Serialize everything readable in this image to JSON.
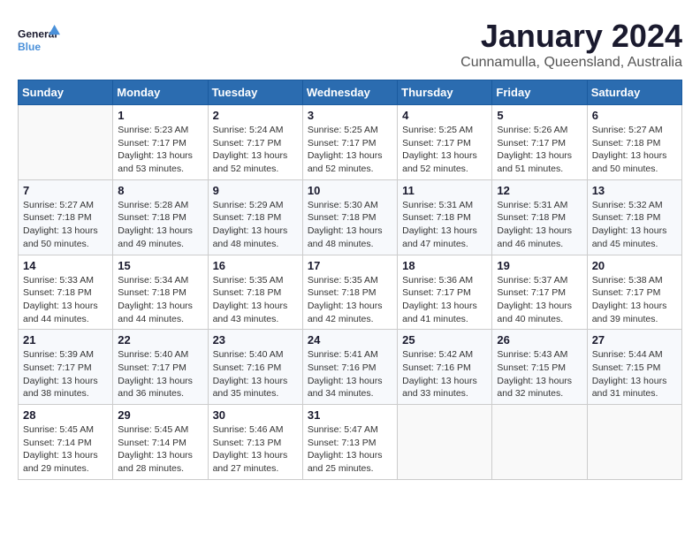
{
  "header": {
    "logo_line1": "General",
    "logo_line2": "Blue",
    "month_year": "January 2024",
    "location": "Cunnamulla, Queensland, Australia"
  },
  "weekdays": [
    "Sunday",
    "Monday",
    "Tuesday",
    "Wednesday",
    "Thursday",
    "Friday",
    "Saturday"
  ],
  "weeks": [
    [
      {
        "day": "",
        "empty": true
      },
      {
        "day": "1",
        "sunrise": "5:23 AM",
        "sunset": "7:17 PM",
        "daylight": "13 hours and 53 minutes."
      },
      {
        "day": "2",
        "sunrise": "5:24 AM",
        "sunset": "7:17 PM",
        "daylight": "13 hours and 52 minutes."
      },
      {
        "day": "3",
        "sunrise": "5:25 AM",
        "sunset": "7:17 PM",
        "daylight": "13 hours and 52 minutes."
      },
      {
        "day": "4",
        "sunrise": "5:25 AM",
        "sunset": "7:17 PM",
        "daylight": "13 hours and 52 minutes."
      },
      {
        "day": "5",
        "sunrise": "5:26 AM",
        "sunset": "7:17 PM",
        "daylight": "13 hours and 51 minutes."
      },
      {
        "day": "6",
        "sunrise": "5:27 AM",
        "sunset": "7:18 PM",
        "daylight": "13 hours and 50 minutes."
      }
    ],
    [
      {
        "day": "7",
        "sunrise": "5:27 AM",
        "sunset": "7:18 PM",
        "daylight": "13 hours and 50 minutes."
      },
      {
        "day": "8",
        "sunrise": "5:28 AM",
        "sunset": "7:18 PM",
        "daylight": "13 hours and 49 minutes."
      },
      {
        "day": "9",
        "sunrise": "5:29 AM",
        "sunset": "7:18 PM",
        "daylight": "13 hours and 48 minutes."
      },
      {
        "day": "10",
        "sunrise": "5:30 AM",
        "sunset": "7:18 PM",
        "daylight": "13 hours and 48 minutes."
      },
      {
        "day": "11",
        "sunrise": "5:31 AM",
        "sunset": "7:18 PM",
        "daylight": "13 hours and 47 minutes."
      },
      {
        "day": "12",
        "sunrise": "5:31 AM",
        "sunset": "7:18 PM",
        "daylight": "13 hours and 46 minutes."
      },
      {
        "day": "13",
        "sunrise": "5:32 AM",
        "sunset": "7:18 PM",
        "daylight": "13 hours and 45 minutes."
      }
    ],
    [
      {
        "day": "14",
        "sunrise": "5:33 AM",
        "sunset": "7:18 PM",
        "daylight": "13 hours and 44 minutes."
      },
      {
        "day": "15",
        "sunrise": "5:34 AM",
        "sunset": "7:18 PM",
        "daylight": "13 hours and 44 minutes."
      },
      {
        "day": "16",
        "sunrise": "5:35 AM",
        "sunset": "7:18 PM",
        "daylight": "13 hours and 43 minutes."
      },
      {
        "day": "17",
        "sunrise": "5:35 AM",
        "sunset": "7:18 PM",
        "daylight": "13 hours and 42 minutes."
      },
      {
        "day": "18",
        "sunrise": "5:36 AM",
        "sunset": "7:17 PM",
        "daylight": "13 hours and 41 minutes."
      },
      {
        "day": "19",
        "sunrise": "5:37 AM",
        "sunset": "7:17 PM",
        "daylight": "13 hours and 40 minutes."
      },
      {
        "day": "20",
        "sunrise": "5:38 AM",
        "sunset": "7:17 PM",
        "daylight": "13 hours and 39 minutes."
      }
    ],
    [
      {
        "day": "21",
        "sunrise": "5:39 AM",
        "sunset": "7:17 PM",
        "daylight": "13 hours and 38 minutes."
      },
      {
        "day": "22",
        "sunrise": "5:40 AM",
        "sunset": "7:17 PM",
        "daylight": "13 hours and 36 minutes."
      },
      {
        "day": "23",
        "sunrise": "5:40 AM",
        "sunset": "7:16 PM",
        "daylight": "13 hours and 35 minutes."
      },
      {
        "day": "24",
        "sunrise": "5:41 AM",
        "sunset": "7:16 PM",
        "daylight": "13 hours and 34 minutes."
      },
      {
        "day": "25",
        "sunrise": "5:42 AM",
        "sunset": "7:16 PM",
        "daylight": "13 hours and 33 minutes."
      },
      {
        "day": "26",
        "sunrise": "5:43 AM",
        "sunset": "7:15 PM",
        "daylight": "13 hours and 32 minutes."
      },
      {
        "day": "27",
        "sunrise": "5:44 AM",
        "sunset": "7:15 PM",
        "daylight": "13 hours and 31 minutes."
      }
    ],
    [
      {
        "day": "28",
        "sunrise": "5:45 AM",
        "sunset": "7:14 PM",
        "daylight": "13 hours and 29 minutes."
      },
      {
        "day": "29",
        "sunrise": "5:45 AM",
        "sunset": "7:14 PM",
        "daylight": "13 hours and 28 minutes."
      },
      {
        "day": "30",
        "sunrise": "5:46 AM",
        "sunset": "7:13 PM",
        "daylight": "13 hours and 27 minutes."
      },
      {
        "day": "31",
        "sunrise": "5:47 AM",
        "sunset": "7:13 PM",
        "daylight": "13 hours and 25 minutes."
      },
      {
        "day": "",
        "empty": true
      },
      {
        "day": "",
        "empty": true
      },
      {
        "day": "",
        "empty": true
      }
    ]
  ],
  "labels": {
    "sunrise_prefix": "Sunrise: ",
    "sunset_prefix": "Sunset: ",
    "daylight_prefix": "Daylight: "
  }
}
